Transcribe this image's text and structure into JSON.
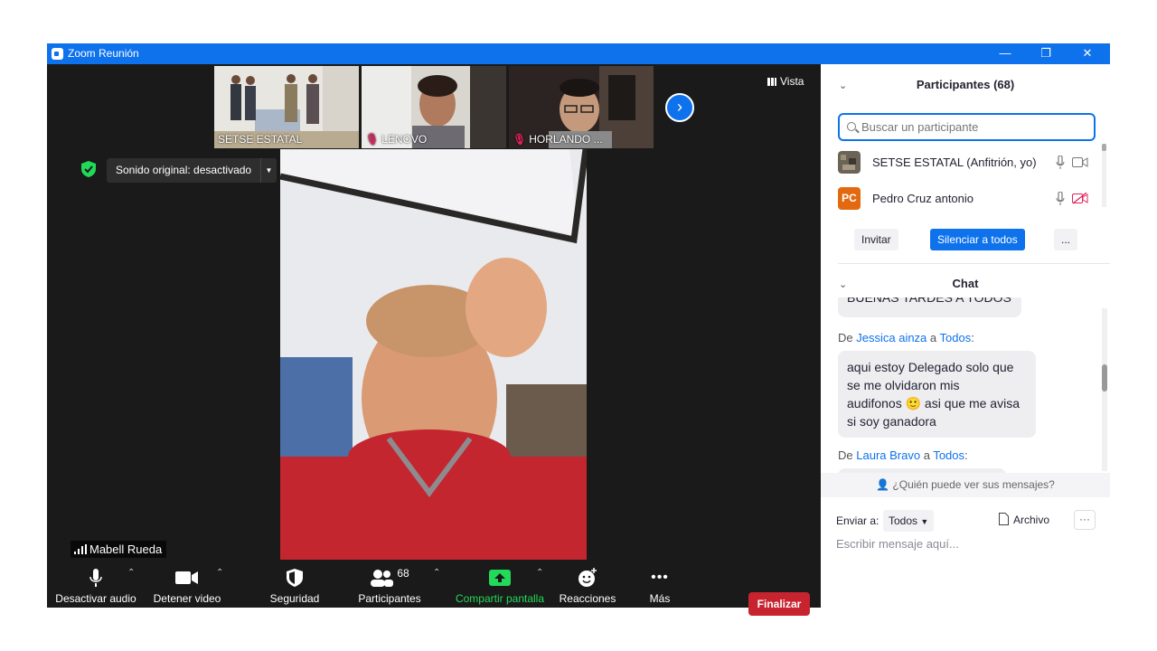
{
  "window": {
    "title": "Zoom Reunión",
    "controls": [
      "—",
      "❐",
      "✕"
    ]
  },
  "thumbnails": [
    {
      "name": "SETSE ESTATAL",
      "muted": false
    },
    {
      "name": "LENOVO",
      "muted": true
    },
    {
      "name": "HORLANDO ...",
      "muted": true
    }
  ],
  "view_button": "Vista",
  "original_sound": "Sonido original: desactivado",
  "active_speaker": "Mabell Rueda",
  "toolbar": {
    "audio": "Desactivar audio",
    "video": "Detener video",
    "security": "Seguridad",
    "participants": "Participantes",
    "participant_count": "68",
    "share": "Compartir pantalla",
    "reactions": "Reacciones",
    "more": "Más",
    "end": "Finalizar"
  },
  "participants_panel": {
    "title": "Participantes (68)",
    "search_placeholder": "Buscar un participante",
    "list": [
      {
        "name": "SETSE ESTATAL (Anfitrión, yo)",
        "initials": ""
      },
      {
        "name": "Pedro Cruz antonio",
        "initials": "PC"
      }
    ],
    "invite": "Invitar",
    "mute_all": "Silenciar a todos",
    "more": "..."
  },
  "chat": {
    "title": "Chat",
    "partial_message": "BUENAS TARDES A TODOS",
    "messages": [
      {
        "prefix": "De",
        "from": "Jessica ainza",
        "connector": "a",
        "to": "Todos",
        "text_lines": [
          "aqui estoy Delegado solo que",
          "se me olvidaron mis",
          "audifonos 🙂 asi que me avisa",
          "si soy ganadora"
        ]
      },
      {
        "prefix": "De",
        "from": "Laura Bravo",
        "connector": "a",
        "to": "Todos",
        "text_lines": []
      }
    ],
    "who_can_see": "¿Quién puede ver sus mensajes?",
    "send_to_label": "Enviar a:",
    "send_to_value": "Todos",
    "file_label": "Archivo",
    "input_placeholder": "Escribir mensaje aquí..."
  },
  "colors": {
    "zoom_blue": "#0e72ed",
    "end_red": "#c7242f",
    "share_green": "#23d959",
    "toolbar_bg": "#1a1a1a"
  }
}
